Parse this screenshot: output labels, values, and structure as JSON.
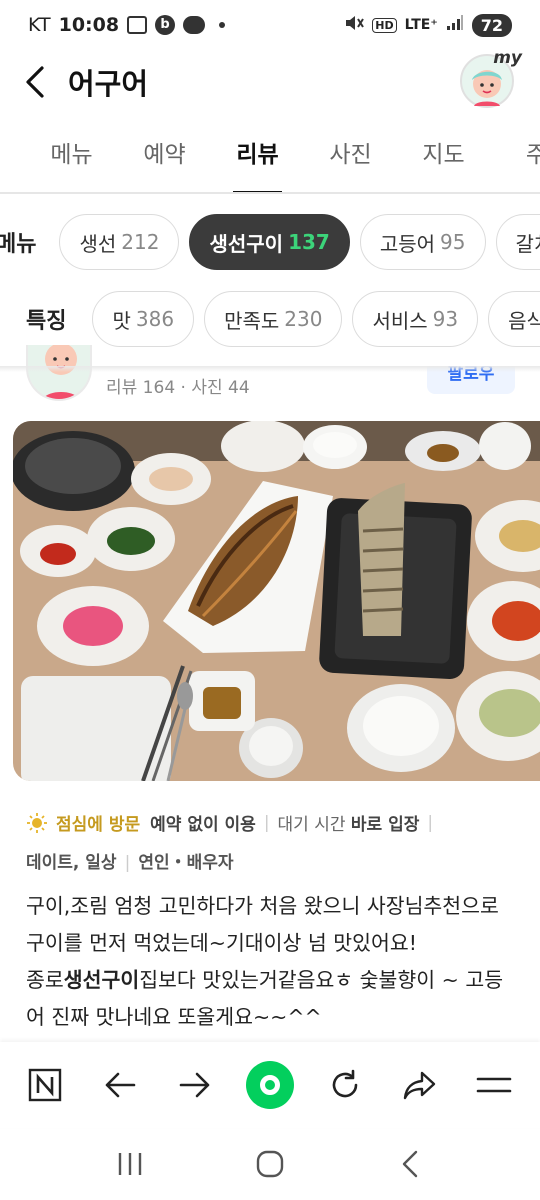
{
  "status_bar": {
    "carrier": "KT",
    "time": "10:08",
    "lte_label": "LTE⁺",
    "hd_label": "HD",
    "battery": "72"
  },
  "header": {
    "title": "어구어",
    "avatar_badge": "my"
  },
  "tabs": [
    {
      "label": "메뉴",
      "active": false
    },
    {
      "label": "예약",
      "active": false
    },
    {
      "label": "리뷰",
      "active": true
    },
    {
      "label": "사진",
      "active": false
    },
    {
      "label": "지도",
      "active": false
    },
    {
      "label": "주",
      "active": false
    }
  ],
  "menu_filter": {
    "label": "메뉴",
    "chips": [
      {
        "name": "생선",
        "count": "212",
        "active": false
      },
      {
        "name": "생선구이",
        "count": "137",
        "active": true
      },
      {
        "name": "고등어",
        "count": "95",
        "active": false
      },
      {
        "name": "갈치",
        "count": "",
        "active": false
      }
    ]
  },
  "feature_filter": {
    "label": "특징",
    "chips": [
      {
        "name": "맛",
        "count": "386"
      },
      {
        "name": "만족도",
        "count": "230"
      },
      {
        "name": "서비스",
        "count": "93"
      },
      {
        "name": "음식량",
        "count": ""
      }
    ]
  },
  "reviewer": {
    "meta": "리뷰 164 · 사진 44",
    "follow_label": "팔로우"
  },
  "visit": {
    "title": "점심에 방문",
    "reservation": "예약 없이 이용",
    "wait_label": "대기 시간",
    "wait_value": "바로 입장",
    "purpose": "데이트, 일상",
    "companion": "연인・배우자"
  },
  "review": {
    "line1_a": "구이,조림 엄청 고민하다가 처음 왔으니 사장님추천으로 구이를 먼저 먹었는데~기대이상 넘 맛있어요!",
    "line2_a": "종로",
    "line2_highlight": "생선구이",
    "line2_b": "집보다 맛있는거같음요ㅎ 숯불향이 ~ 고등어 진짜 맛나네요 또올게요~~^^"
  },
  "colors": {
    "accent_green": "#03cf5d",
    "chip_active_bg": "#3b3b3b",
    "chip_active_count": "#3cd47a",
    "visit_title": "#c59a1f",
    "follow_blue": "#2f6df2"
  },
  "icons": {
    "back": "chevron-left-icon",
    "toolbar": [
      "naver-n-icon",
      "arrow-left-icon",
      "arrow-right-icon",
      "green-home-icon",
      "refresh-icon",
      "share-icon",
      "menu-icon"
    ],
    "navbar": [
      "recent-apps-icon",
      "home-icon",
      "back-icon"
    ]
  }
}
